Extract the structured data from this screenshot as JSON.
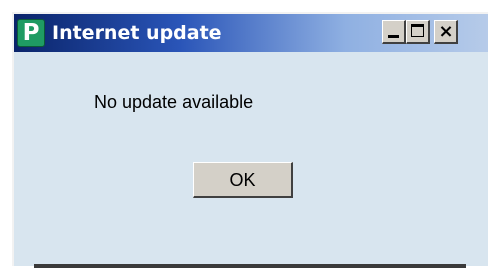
{
  "window": {
    "title": "Internet update",
    "app_icon_letter": "P",
    "app_icon": "p-logo-icon",
    "controls": {
      "minimize": "minimize-icon",
      "maximize": "maximize-icon",
      "close": "close-icon",
      "close_glyph": "×"
    }
  },
  "dialog": {
    "message": "No update available",
    "ok_label": "OK"
  },
  "colors": {
    "titlebar_start": "#0a246a",
    "titlebar_end": "#b6cbe9",
    "window_bg": "#d8e5ef",
    "button_face": "#d4d0c8",
    "app_icon_bg": "#1f9b63"
  }
}
